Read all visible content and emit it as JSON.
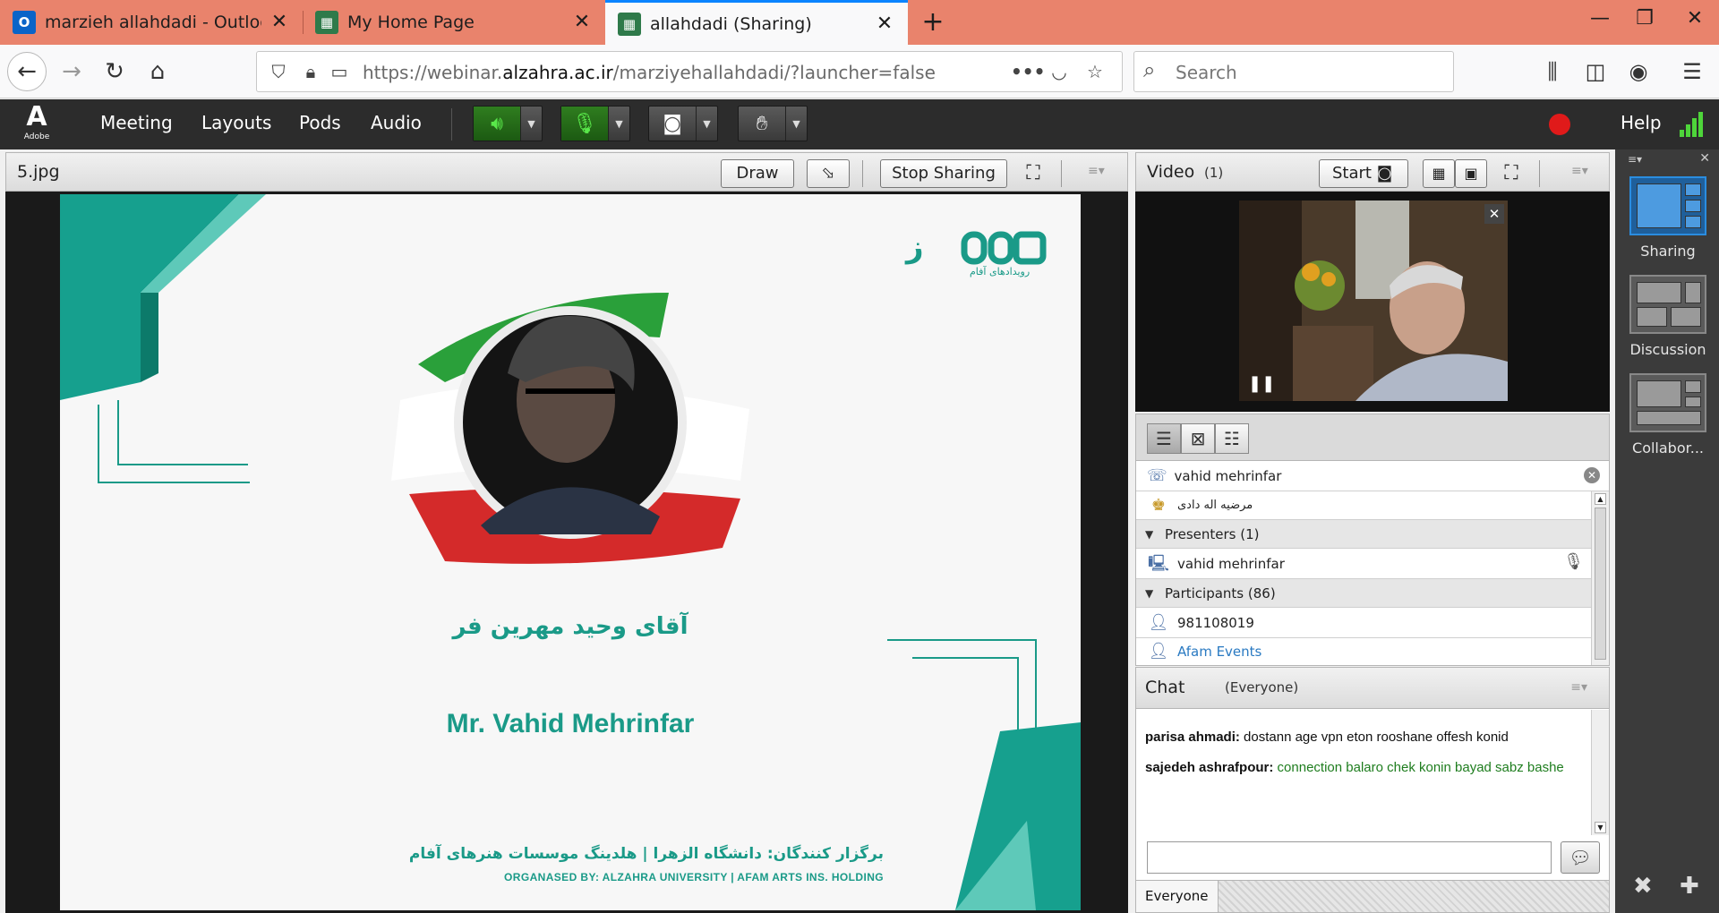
{
  "browser": {
    "tabs": [
      {
        "title": "marzieh allahdadi - Outlook W",
        "icon": "outlook-icon"
      },
      {
        "title": "My Home Page",
        "icon": "adobe-connect-icon"
      },
      {
        "title": "allahdadi (Sharing)",
        "icon": "adobe-connect-icon",
        "active": true
      }
    ],
    "url": {
      "prefix": "https://webinar.",
      "host": "alzahra.ac.ir",
      "path": "/marziyehallahdadi/?launcher=false"
    },
    "search_placeholder": "Search"
  },
  "connect": {
    "menus": [
      "Meeting",
      "Layouts",
      "Pods",
      "Audio"
    ],
    "logo_sub": "Adobe",
    "help": "Help"
  },
  "share_pod": {
    "title": "5.jpg",
    "draw_label": "Draw",
    "stop_sharing_label": "Stop Sharing"
  },
  "slide": {
    "name_fa": "آقای وحید مهرین فر",
    "name_en": "Mr. Vahid Mehrinfar",
    "organizer_fa": "برگزار کنندگان: دانشگاه الزهرا | هلدینگ موسسات هنرهای آفام",
    "organizer_en": "ORGANASED BY: ALZAHRA UNIVERSITY | AFAM ARTS INS. HOLDING",
    "logo_text": "رویدادهای آفام"
  },
  "video_pod": {
    "title": "Video",
    "count": "(1)",
    "start_label": "Start"
  },
  "attendees": {
    "search_name": "vahid mehrinfar",
    "host_row": "مرضیه اله دادی",
    "presenters_label": "Presenters (1)",
    "presenters": [
      "vahid mehrinfar"
    ],
    "participants_label": "Participants (86)",
    "participants": [
      "981108019",
      "Afam Events"
    ]
  },
  "chat": {
    "title": "Chat",
    "scope": "(Everyone)",
    "messages": [
      {
        "from": "parisa ahmadi:",
        "text": "dostann age vpn eton rooshane offesh konid",
        "color": "black"
      },
      {
        "from": "sajedeh ashrafpour:",
        "text": "connection balaro chek konin bayad sabz bashe",
        "color": "green"
      }
    ],
    "input_value": "",
    "tab_label": "Everyone"
  },
  "layouts": {
    "items": [
      "Sharing",
      "Discussion",
      "Collabor..."
    ]
  },
  "colors": {
    "tabbar": "#e9836c",
    "connect_bar": "#2c2c2c",
    "slide_teal": "#1a9a88",
    "mic_green": "#59e84a",
    "record_red": "#e01a1a",
    "chat_green": "#1e7d1e"
  }
}
